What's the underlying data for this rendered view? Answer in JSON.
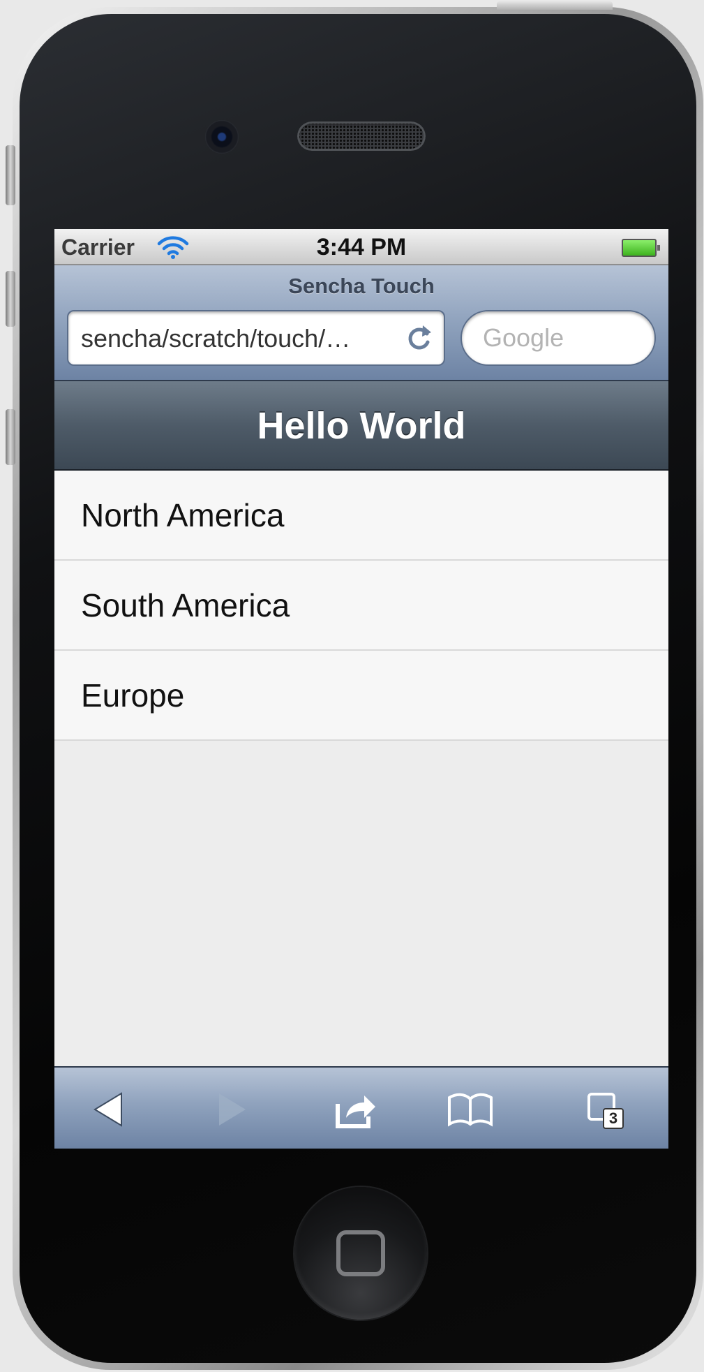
{
  "status_bar": {
    "carrier": "Carrier",
    "time": "3:44 PM"
  },
  "browser": {
    "page_title": "Sencha Touch",
    "url": "sencha/scratch/touch/…",
    "search_placeholder": "Google"
  },
  "app": {
    "title": "Hello World",
    "list_items": [
      "North America",
      "South America",
      "Europe"
    ]
  },
  "bottom_bar": {
    "buttons": [
      "back-icon",
      "forward-icon",
      "share-icon",
      "bookmarks-icon",
      "tabs-icon"
    ],
    "tabs_count": "3"
  },
  "colors": {
    "toolbar": "#4e5b68",
    "browser_bar": "#8fa2bd",
    "list_bg": "#f7f7f7"
  }
}
